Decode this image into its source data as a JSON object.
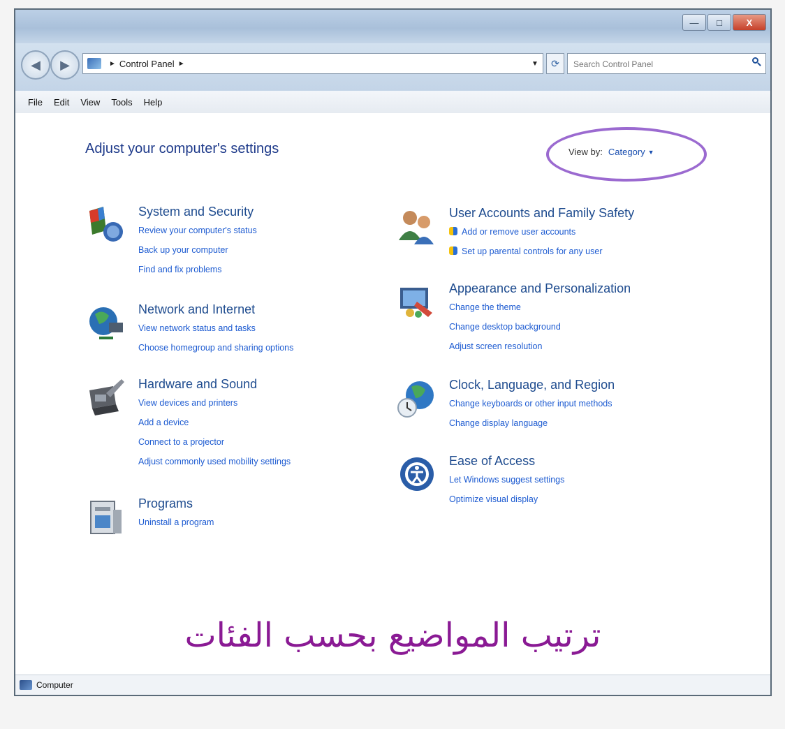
{
  "window": {
    "controls": {
      "minimize": "—",
      "maximize": "□",
      "close": "X"
    }
  },
  "nav": {
    "back": "◀",
    "forward": "▶",
    "breadcrumb": [
      "Control Panel"
    ],
    "search_placeholder": "Search Control Panel"
  },
  "menu": [
    "File",
    "Edit",
    "View",
    "Tools",
    "Help"
  ],
  "content": {
    "title": "Adjust your computer's settings",
    "view_by_label": "View by:",
    "view_by_value": "Category",
    "left_categories": [
      {
        "title": "System and Security",
        "icon": "system-security-icon",
        "links": [
          "Review your computer's status",
          "Back up your computer",
          "Find and fix problems"
        ]
      },
      {
        "title": "Network and Internet",
        "icon": "network-internet-icon",
        "links": [
          "View network status and tasks",
          "Choose homegroup and sharing options"
        ]
      },
      {
        "title": "Hardware and Sound",
        "icon": "hardware-sound-icon",
        "links": [
          "View devices and printers",
          "Add a device",
          "Connect to a projector",
          "Adjust commonly used mobility settings"
        ]
      },
      {
        "title": "Programs",
        "icon": "programs-icon",
        "links": [
          "Uninstall a program"
        ]
      }
    ],
    "right_categories": [
      {
        "title": "User Accounts and Family Safety",
        "icon": "user-accounts-icon",
        "links": [
          "Add or remove user accounts",
          "Set up parental controls for any user"
        ]
      },
      {
        "title": "Appearance and Personalization",
        "icon": "appearance-icon",
        "links": [
          "Change the theme",
          "Change desktop background",
          "Adjust screen resolution"
        ]
      },
      {
        "title": "Clock, Language, and Region",
        "icon": "clock-language-icon",
        "links": [
          "Change keyboards or other input methods",
          "Change display language"
        ]
      },
      {
        "title": "Ease of Access",
        "icon": "ease-of-access-icon",
        "links": [
          "Let Windows suggest settings",
          "Optimize visual display"
        ]
      }
    ],
    "caption_arabic": "ترتيب المواضيع بحسب الفئات"
  },
  "status": {
    "label": "Computer"
  }
}
